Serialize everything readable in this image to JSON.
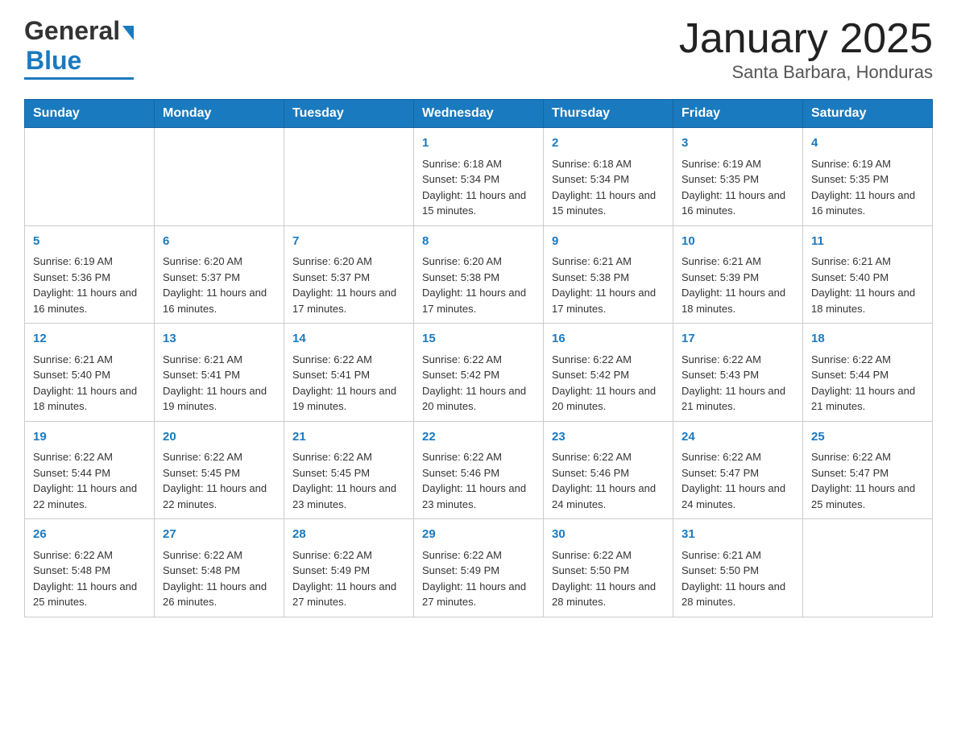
{
  "header": {
    "logo_general": "General",
    "logo_blue": "Blue",
    "title": "January 2025",
    "subtitle": "Santa Barbara, Honduras"
  },
  "days_of_week": [
    "Sunday",
    "Monday",
    "Tuesday",
    "Wednesday",
    "Thursday",
    "Friday",
    "Saturday"
  ],
  "weeks": [
    [
      {
        "day": "",
        "sunrise": "",
        "sunset": "",
        "daylight": ""
      },
      {
        "day": "",
        "sunrise": "",
        "sunset": "",
        "daylight": ""
      },
      {
        "day": "",
        "sunrise": "",
        "sunset": "",
        "daylight": ""
      },
      {
        "day": "1",
        "sunrise": "Sunrise: 6:18 AM",
        "sunset": "Sunset: 5:34 PM",
        "daylight": "Daylight: 11 hours and 15 minutes."
      },
      {
        "day": "2",
        "sunrise": "Sunrise: 6:18 AM",
        "sunset": "Sunset: 5:34 PM",
        "daylight": "Daylight: 11 hours and 15 minutes."
      },
      {
        "day": "3",
        "sunrise": "Sunrise: 6:19 AM",
        "sunset": "Sunset: 5:35 PM",
        "daylight": "Daylight: 11 hours and 16 minutes."
      },
      {
        "day": "4",
        "sunrise": "Sunrise: 6:19 AM",
        "sunset": "Sunset: 5:35 PM",
        "daylight": "Daylight: 11 hours and 16 minutes."
      }
    ],
    [
      {
        "day": "5",
        "sunrise": "Sunrise: 6:19 AM",
        "sunset": "Sunset: 5:36 PM",
        "daylight": "Daylight: 11 hours and 16 minutes."
      },
      {
        "day": "6",
        "sunrise": "Sunrise: 6:20 AM",
        "sunset": "Sunset: 5:37 PM",
        "daylight": "Daylight: 11 hours and 16 minutes."
      },
      {
        "day": "7",
        "sunrise": "Sunrise: 6:20 AM",
        "sunset": "Sunset: 5:37 PM",
        "daylight": "Daylight: 11 hours and 17 minutes."
      },
      {
        "day": "8",
        "sunrise": "Sunrise: 6:20 AM",
        "sunset": "Sunset: 5:38 PM",
        "daylight": "Daylight: 11 hours and 17 minutes."
      },
      {
        "day": "9",
        "sunrise": "Sunrise: 6:21 AM",
        "sunset": "Sunset: 5:38 PM",
        "daylight": "Daylight: 11 hours and 17 minutes."
      },
      {
        "day": "10",
        "sunrise": "Sunrise: 6:21 AM",
        "sunset": "Sunset: 5:39 PM",
        "daylight": "Daylight: 11 hours and 18 minutes."
      },
      {
        "day": "11",
        "sunrise": "Sunrise: 6:21 AM",
        "sunset": "Sunset: 5:40 PM",
        "daylight": "Daylight: 11 hours and 18 minutes."
      }
    ],
    [
      {
        "day": "12",
        "sunrise": "Sunrise: 6:21 AM",
        "sunset": "Sunset: 5:40 PM",
        "daylight": "Daylight: 11 hours and 18 minutes."
      },
      {
        "day": "13",
        "sunrise": "Sunrise: 6:21 AM",
        "sunset": "Sunset: 5:41 PM",
        "daylight": "Daylight: 11 hours and 19 minutes."
      },
      {
        "day": "14",
        "sunrise": "Sunrise: 6:22 AM",
        "sunset": "Sunset: 5:41 PM",
        "daylight": "Daylight: 11 hours and 19 minutes."
      },
      {
        "day": "15",
        "sunrise": "Sunrise: 6:22 AM",
        "sunset": "Sunset: 5:42 PM",
        "daylight": "Daylight: 11 hours and 20 minutes."
      },
      {
        "day": "16",
        "sunrise": "Sunrise: 6:22 AM",
        "sunset": "Sunset: 5:42 PM",
        "daylight": "Daylight: 11 hours and 20 minutes."
      },
      {
        "day": "17",
        "sunrise": "Sunrise: 6:22 AM",
        "sunset": "Sunset: 5:43 PM",
        "daylight": "Daylight: 11 hours and 21 minutes."
      },
      {
        "day": "18",
        "sunrise": "Sunrise: 6:22 AM",
        "sunset": "Sunset: 5:44 PM",
        "daylight": "Daylight: 11 hours and 21 minutes."
      }
    ],
    [
      {
        "day": "19",
        "sunrise": "Sunrise: 6:22 AM",
        "sunset": "Sunset: 5:44 PM",
        "daylight": "Daylight: 11 hours and 22 minutes."
      },
      {
        "day": "20",
        "sunrise": "Sunrise: 6:22 AM",
        "sunset": "Sunset: 5:45 PM",
        "daylight": "Daylight: 11 hours and 22 minutes."
      },
      {
        "day": "21",
        "sunrise": "Sunrise: 6:22 AM",
        "sunset": "Sunset: 5:45 PM",
        "daylight": "Daylight: 11 hours and 23 minutes."
      },
      {
        "day": "22",
        "sunrise": "Sunrise: 6:22 AM",
        "sunset": "Sunset: 5:46 PM",
        "daylight": "Daylight: 11 hours and 23 minutes."
      },
      {
        "day": "23",
        "sunrise": "Sunrise: 6:22 AM",
        "sunset": "Sunset: 5:46 PM",
        "daylight": "Daylight: 11 hours and 24 minutes."
      },
      {
        "day": "24",
        "sunrise": "Sunrise: 6:22 AM",
        "sunset": "Sunset: 5:47 PM",
        "daylight": "Daylight: 11 hours and 24 minutes."
      },
      {
        "day": "25",
        "sunrise": "Sunrise: 6:22 AM",
        "sunset": "Sunset: 5:47 PM",
        "daylight": "Daylight: 11 hours and 25 minutes."
      }
    ],
    [
      {
        "day": "26",
        "sunrise": "Sunrise: 6:22 AM",
        "sunset": "Sunset: 5:48 PM",
        "daylight": "Daylight: 11 hours and 25 minutes."
      },
      {
        "day": "27",
        "sunrise": "Sunrise: 6:22 AM",
        "sunset": "Sunset: 5:48 PM",
        "daylight": "Daylight: 11 hours and 26 minutes."
      },
      {
        "day": "28",
        "sunrise": "Sunrise: 6:22 AM",
        "sunset": "Sunset: 5:49 PM",
        "daylight": "Daylight: 11 hours and 27 minutes."
      },
      {
        "day": "29",
        "sunrise": "Sunrise: 6:22 AM",
        "sunset": "Sunset: 5:49 PM",
        "daylight": "Daylight: 11 hours and 27 minutes."
      },
      {
        "day": "30",
        "sunrise": "Sunrise: 6:22 AM",
        "sunset": "Sunset: 5:50 PM",
        "daylight": "Daylight: 11 hours and 28 minutes."
      },
      {
        "day": "31",
        "sunrise": "Sunrise: 6:21 AM",
        "sunset": "Sunset: 5:50 PM",
        "daylight": "Daylight: 11 hours and 28 minutes."
      },
      {
        "day": "",
        "sunrise": "",
        "sunset": "",
        "daylight": ""
      }
    ]
  ]
}
